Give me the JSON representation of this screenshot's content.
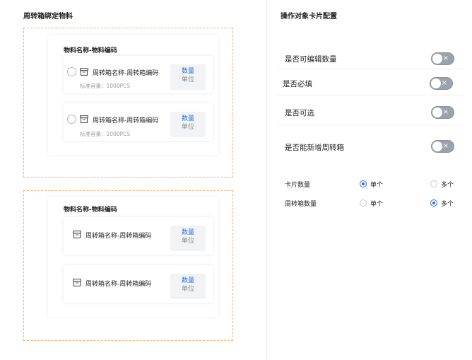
{
  "left": {
    "title": "周转箱绑定物料",
    "groups": [
      {
        "panel_title": "物料名称-物料编码",
        "cards": [
          {
            "name": "周转箱名称-周转箱编码",
            "capacity": "标准容量：1000PCS",
            "qty_label": "数量",
            "unit_label": "单位"
          },
          {
            "name": "周转箱名称-周转箱编码",
            "capacity": "标准容量：1000PCS",
            "qty_label": "数量",
            "unit_label": "单位"
          }
        ]
      },
      {
        "panel_title": "物料名称-物料编码",
        "cards": [
          {
            "name": "周转箱名称-周转箱编码",
            "qty_label": "数量",
            "unit_label": "单位"
          },
          {
            "name": "周转箱名称-周转箱编码",
            "qty_label": "数量",
            "unit_label": "单位"
          }
        ]
      }
    ]
  },
  "right": {
    "title": "操作对象卡片配置",
    "toggles": [
      {
        "label": "是否可编辑数量",
        "on": false,
        "off_symbol": "×"
      },
      {
        "label": "是否必填",
        "on": false,
        "off_symbol": "×"
      },
      {
        "label": "是否可选",
        "on": false,
        "off_symbol": "×"
      },
      {
        "label": "是否能新增周转箱",
        "on": false,
        "off_symbol": "×"
      }
    ],
    "options": [
      {
        "label": "卡片数量",
        "choices": [
          "单个",
          "多个"
        ],
        "selected": "单个"
      },
      {
        "label": "周转箱数量",
        "choices": [
          "单个",
          "多个"
        ],
        "selected": "多个"
      }
    ]
  },
  "colors": {
    "accent": "#2f6ce0",
    "dashed_border": "#f0b27a",
    "toggle_off": "#9aa3ab"
  }
}
